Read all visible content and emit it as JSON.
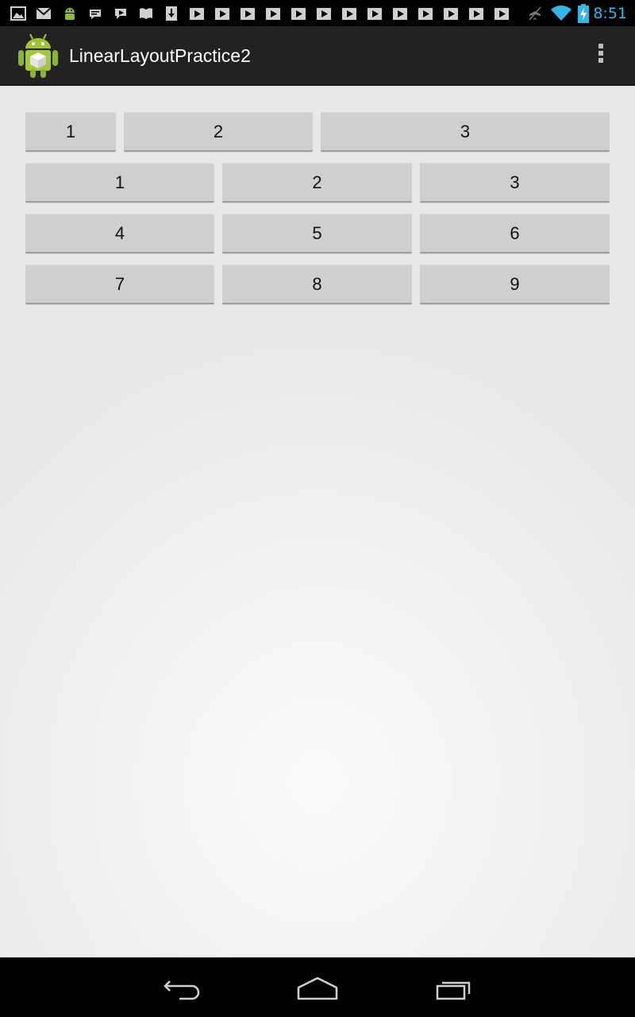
{
  "status_bar": {
    "time": "8:51",
    "notification_icons": [
      "gallery-icon",
      "gmail-icon",
      "android-debug-icon",
      "message-icon",
      "hangouts-icon",
      "books-icon",
      "download-icon",
      "play-icon",
      "play-icon",
      "play-icon",
      "play-icon",
      "play-icon",
      "play-icon",
      "play-icon",
      "play-icon",
      "play-icon",
      "play-icon",
      "play-icon",
      "play-icon"
    ],
    "system_icons": [
      "airplane-mode-off-icon",
      "wifi-icon",
      "battery-charging-icon"
    ]
  },
  "action_bar": {
    "title": "LinearLayoutPractice2",
    "app_icon": "android-app-icon",
    "overflow_icon": "overflow-menu-icon"
  },
  "rows": [
    {
      "buttons": [
        {
          "label": "1"
        },
        {
          "label": "2"
        },
        {
          "label": "3"
        }
      ]
    },
    {
      "buttons": [
        {
          "label": "1"
        },
        {
          "label": "2"
        },
        {
          "label": "3"
        }
      ]
    },
    {
      "buttons": [
        {
          "label": "4"
        },
        {
          "label": "5"
        },
        {
          "label": "6"
        }
      ]
    },
    {
      "buttons": [
        {
          "label": "7"
        },
        {
          "label": "8"
        },
        {
          "label": "9"
        }
      ]
    }
  ],
  "nav_bar": {
    "buttons": [
      "back-icon",
      "home-icon",
      "recent-apps-icon"
    ]
  },
  "colors": {
    "status_time": "#33b5e5",
    "action_bar": "#222222",
    "button": "#cfcfcf"
  }
}
